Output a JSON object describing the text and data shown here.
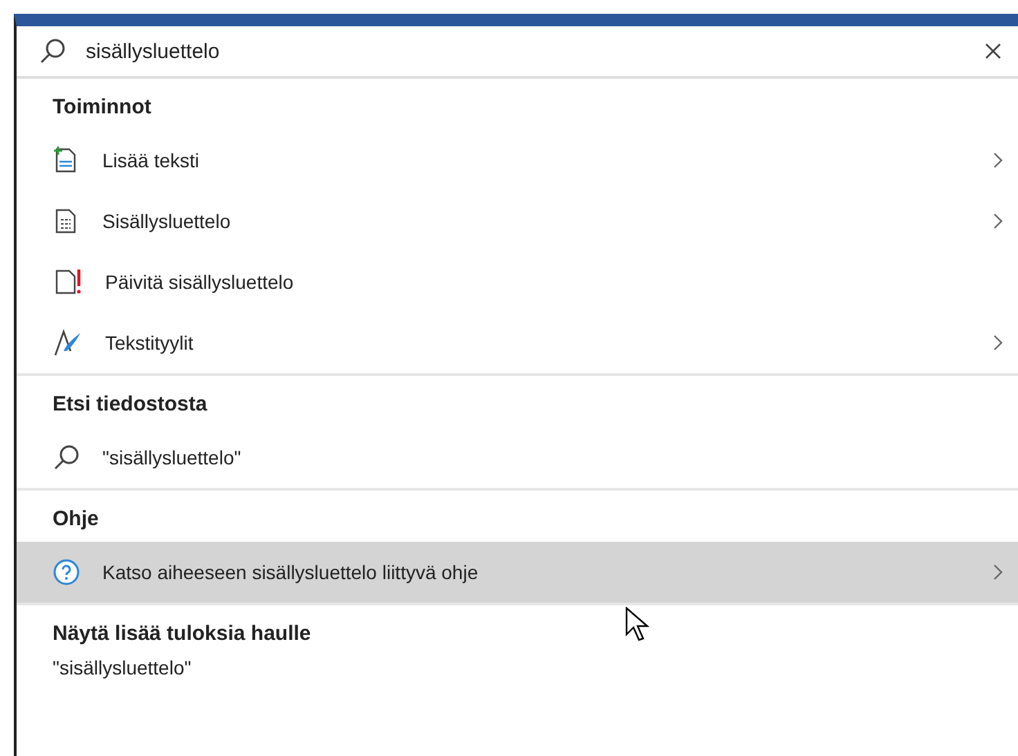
{
  "search": {
    "value": "sisällysluettelo"
  },
  "sections": [
    {
      "kind": "actions",
      "title": "Toiminnot",
      "items": [
        {
          "label": "Lisää teksti",
          "submenu": true,
          "selected": false
        },
        {
          "label": "Sisällysluettelo",
          "submenu": true,
          "selected": false
        },
        {
          "label": "Päivitä sisällysluettelo",
          "submenu": false,
          "selected": false
        },
        {
          "label": "Tekstityylit",
          "submenu": true,
          "selected": false
        }
      ]
    },
    {
      "kind": "search",
      "title": "Etsi tiedostosta",
      "items": [
        {
          "label": "\"sisällysluettelo\"",
          "submenu": false,
          "selected": false
        }
      ]
    },
    {
      "kind": "help",
      "title": "Ohje",
      "items": [
        {
          "label": "Katso aiheeseen sisällysluettelo liittyvä ohje",
          "submenu": true,
          "selected": true
        }
      ]
    }
  ],
  "more": {
    "title": "Näytä lisää tuloksia haulle",
    "query": "\"sisällysluettelo\""
  }
}
